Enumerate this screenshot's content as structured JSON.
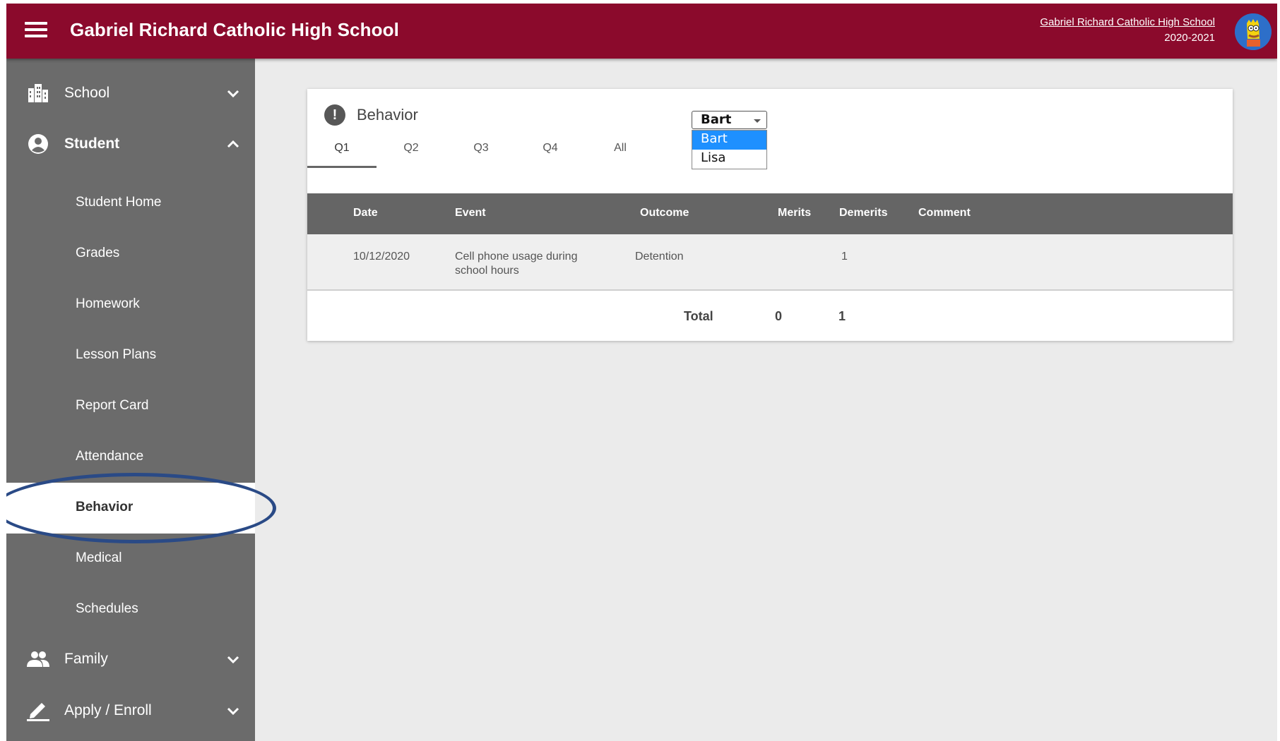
{
  "header": {
    "title": "Gabriel Richard Catholic High School",
    "school_link": "Gabriel Richard Catholic High School",
    "school_year": "2020-2021"
  },
  "sidebar": {
    "sections": [
      {
        "label": "School",
        "icon": "building-icon",
        "expanded": false
      },
      {
        "label": "Student",
        "icon": "account-circle-icon",
        "expanded": true
      },
      {
        "label": "Family",
        "icon": "people-icon",
        "expanded": false
      },
      {
        "label": "Apply / Enroll",
        "icon": "pencil-icon",
        "expanded": false
      }
    ],
    "student_items": [
      "Student Home",
      "Grades",
      "Homework",
      "Lesson Plans",
      "Report Card",
      "Attendance",
      "Behavior",
      "Medical",
      "Schedules"
    ],
    "active_item": "Behavior"
  },
  "card": {
    "title": "Behavior",
    "tabs": [
      "Q1",
      "Q2",
      "Q3",
      "Q4",
      "All"
    ],
    "active_tab": "Q1",
    "student_select": {
      "value": "Bart",
      "options": [
        "Bart",
        "Lisa"
      ],
      "highlighted": "Bart"
    },
    "table": {
      "columns": [
        "Date",
        "Event",
        "Outcome",
        "Merits",
        "Demerits",
        "Comment"
      ],
      "rows": [
        {
          "date": "10/12/2020",
          "event_line1": "Cell phone usage during",
          "event_line2": "school hours",
          "outcome": "Detention",
          "merits": "",
          "demerits": "1",
          "comment": ""
        }
      ],
      "total_label": "Total",
      "total_merits": "0",
      "total_demerits": "1"
    }
  },
  "colors": {
    "header_bg": "#8b0a2c",
    "sidebar_bg": "#6b6b6b",
    "table_header_bg": "#656565",
    "dropdown_selected": "#1e90ff",
    "highlight_ring": "#2a4a86"
  }
}
